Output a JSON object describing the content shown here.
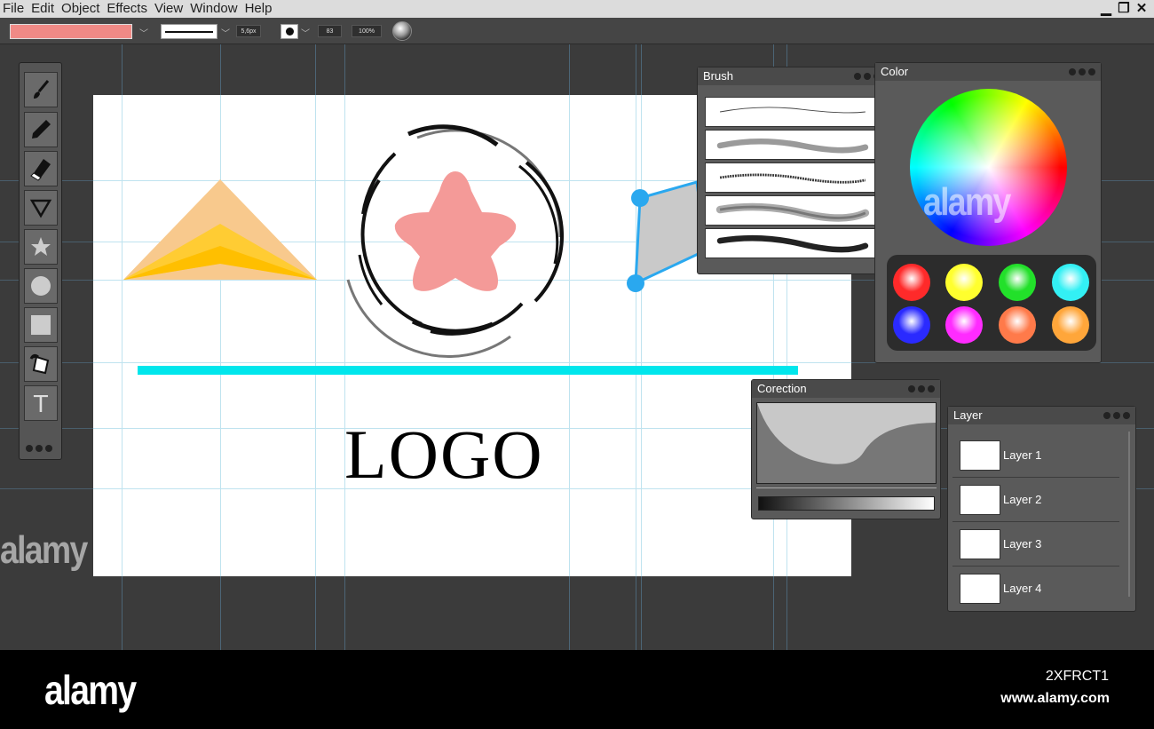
{
  "menu": {
    "items": [
      "File",
      "Edit",
      "Object",
      "Effects",
      "View",
      "Window",
      "Help"
    ]
  },
  "window_controls": {
    "minimize": "▁",
    "restore": "❐",
    "close": "✕"
  },
  "options_bar": {
    "fill_color": "#f08a86",
    "stroke_size": "5,6px",
    "value_field": "83",
    "opacity": "100%"
  },
  "tools": [
    "brush-icon",
    "pen-icon",
    "eraser-icon",
    "triangle-icon",
    "star-icon",
    "circle-icon",
    "rectangle-icon",
    "paint-bucket-icon",
    "text-icon"
  ],
  "tools_text_label": "T",
  "artboard": {
    "logo_text": "LOGO",
    "accent_line_color": "#00e6ec",
    "star_color": "#f49a98"
  },
  "brush_panel": {
    "title": "Brush"
  },
  "color_panel": {
    "title": "Color",
    "swatches": [
      "#ff2a2a",
      "#ffff2e",
      "#22e02a",
      "#33f0f4",
      "#2a2aff",
      "#ff2bff",
      "#ff7a4a",
      "#ffa63a"
    ]
  },
  "correction_panel": {
    "title": "Corection"
  },
  "layer_panel": {
    "title": "Layer",
    "layers": [
      "Layer 1",
      "Layer 2",
      "Layer 3",
      "Layer 4"
    ]
  },
  "watermark": {
    "logo": "alamy",
    "image_id": "2XFRCT1",
    "url": "www.alamy.com"
  }
}
